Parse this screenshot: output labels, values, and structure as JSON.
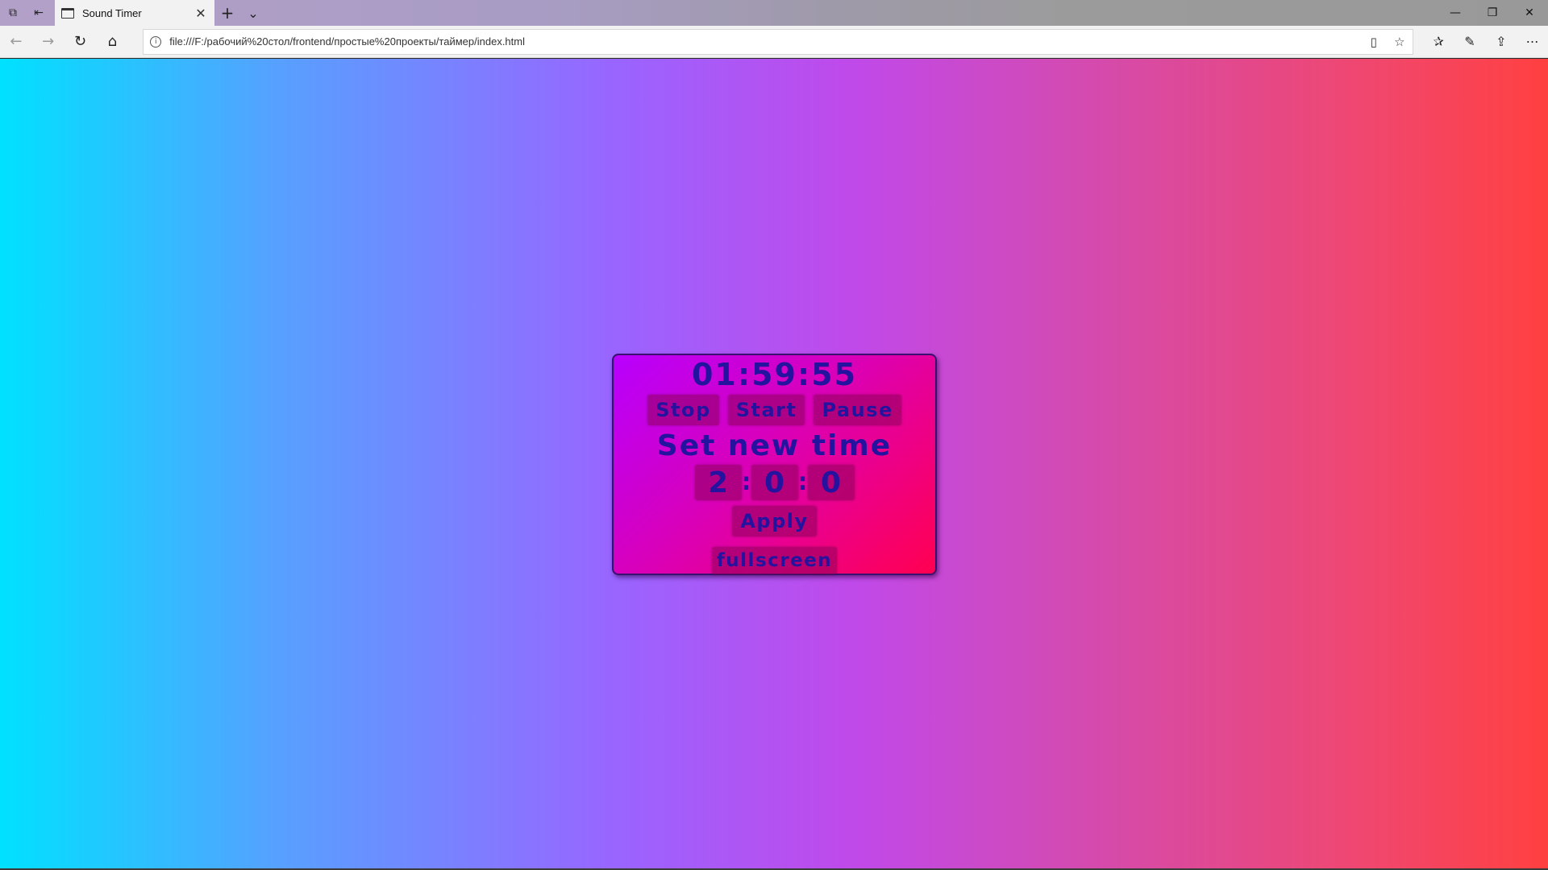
{
  "browser": {
    "tab": {
      "title": "Sound Timer",
      "close_glyph": "✕"
    },
    "new_tab_glyph": "+",
    "tab_list_glyph": "⌄",
    "window_controls": {
      "minimize": "—",
      "restore": "❐",
      "close": "✕"
    },
    "nav": {
      "back": "←",
      "forward": "→",
      "refresh": "↻",
      "home": "⌂"
    },
    "address": {
      "url": "file:///F:/рабочий%20стол/frontend/простые%20проекты/таймер/index.html",
      "info_glyph": "i"
    },
    "address_buttons": {
      "reading_view": "▯",
      "favorite": "☆"
    },
    "tools": {
      "favorites": "✰",
      "notes": "✎",
      "share": "⇪",
      "more": "⋯"
    },
    "titlebar_left_icons": {
      "tabs_aside": "⧉",
      "set_aside": "⇤"
    }
  },
  "timer": {
    "current_time": "01:59:55",
    "buttons": {
      "stop": "Stop",
      "start": "Start",
      "pause": "Pause"
    },
    "set_title": "Set new time",
    "new_time": {
      "hours": "2",
      "minutes": "0",
      "seconds": "0",
      "separator": ":"
    },
    "apply_label": "Apply",
    "fullscreen_label": "fullscreen"
  },
  "colors": {
    "text_accent": "#24139e",
    "card_gradient_start": "#b800ff",
    "card_gradient_end": "#ff0050",
    "background_left": "#00e1ff",
    "background_right": "#ff4040"
  }
}
